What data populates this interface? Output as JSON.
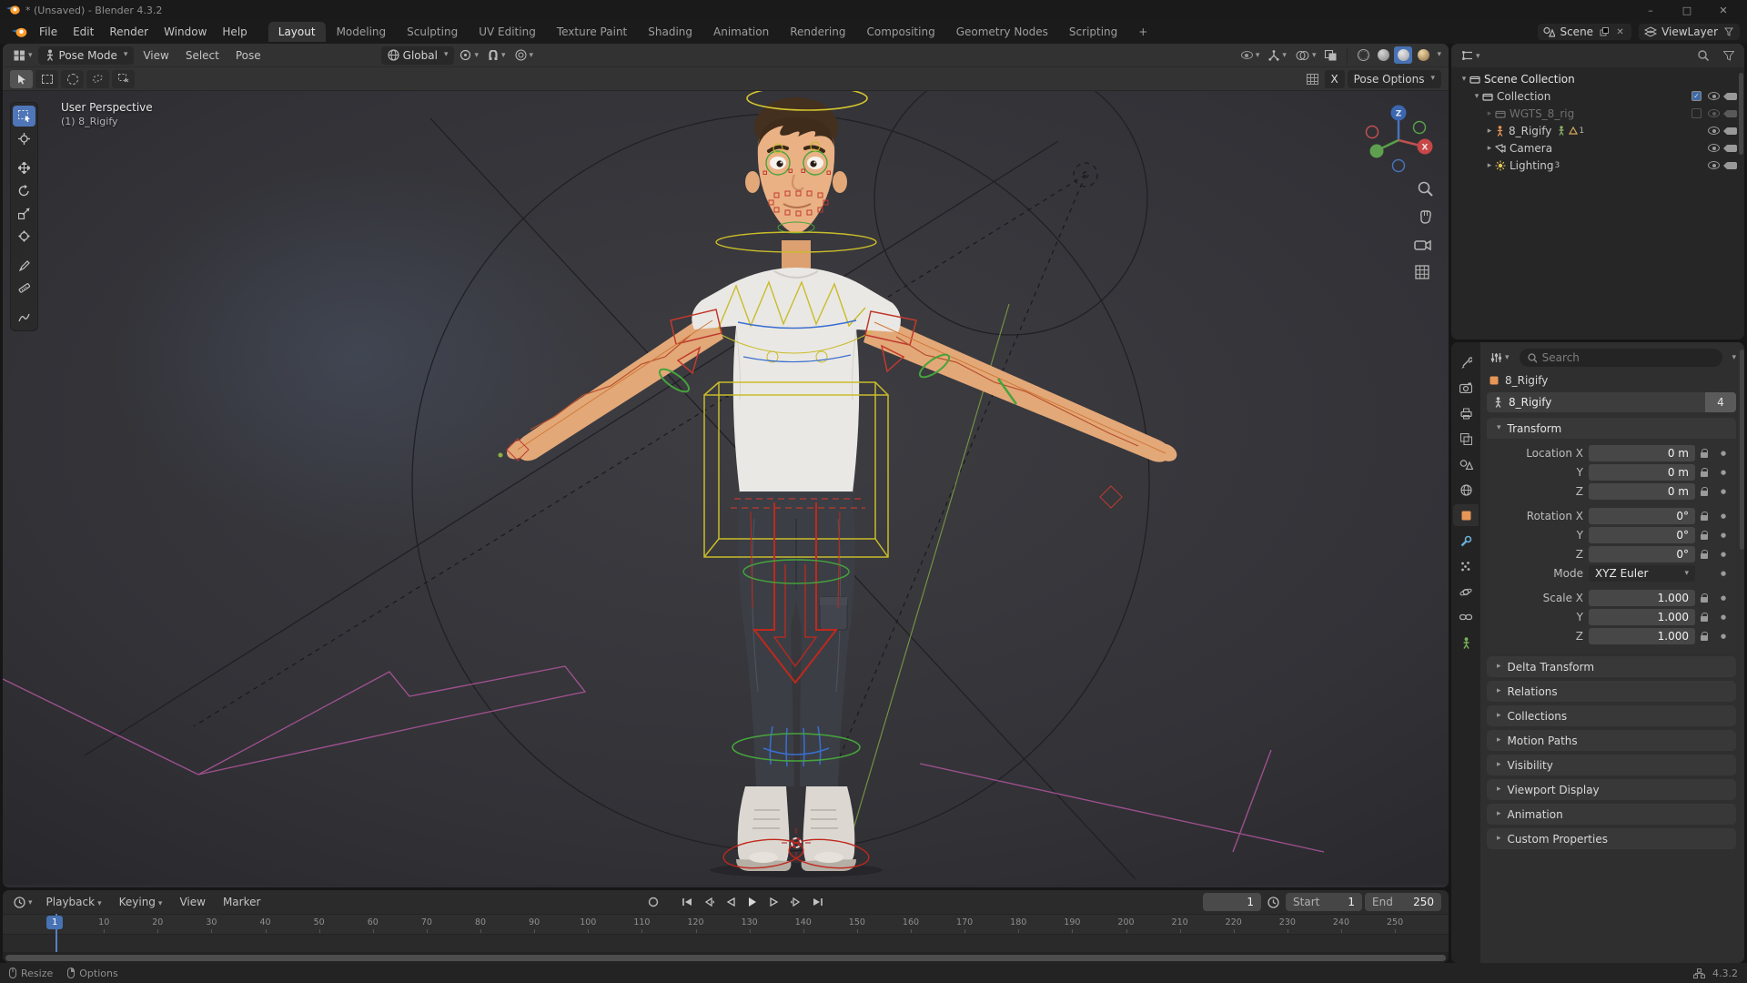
{
  "colors": {
    "accent": "#4772b3",
    "axis_x": "#c54747",
    "axis_y": "#5fa04f",
    "axis_z": "#3b66b0",
    "rig_yellow": "#c9bc2a",
    "rig_red": "#c0392b",
    "rig_green": "#46a33c",
    "rig_blue": "#3a6fd0",
    "rig_pink": "#b0569c",
    "rig_orange": "#d07838"
  },
  "icons": {
    "chevron_down": "▾",
    "chevron_right": "▸",
    "check": "✓",
    "close": "✕",
    "dot": "●",
    "minimize": "–",
    "maximize": "□",
    "plus": "+"
  },
  "titlebar": {
    "title": "* (Unsaved) - Blender 4.3.2"
  },
  "menubar": {
    "menus": [
      "File",
      "Edit",
      "Render",
      "Window",
      "Help"
    ],
    "workspaces": [
      "Layout",
      "Modeling",
      "Sculpting",
      "UV Editing",
      "Texture Paint",
      "Shading",
      "Animation",
      "Rendering",
      "Compositing",
      "Geometry Nodes",
      "Scripting"
    ],
    "active_workspace": "Layout",
    "scene_label": "Scene",
    "viewlayer_label": "ViewLayer"
  },
  "viewport_header": {
    "mode": "Pose Mode",
    "menus": [
      "View",
      "Select",
      "Pose"
    ],
    "orientation": "Global"
  },
  "tool_settings": {
    "mirror_x": "X",
    "pose_options": "Pose Options"
  },
  "viewport": {
    "view_label": "User Perspective",
    "object_label": "(1) 8_Rigify",
    "gizmo": {
      "x": "X",
      "z": "Z"
    }
  },
  "outliner": {
    "rows": [
      {
        "label": "Scene Collection",
        "depth": 0
      },
      {
        "label": "Collection",
        "depth": 1
      },
      {
        "label": "WGTS_8_rig",
        "depth": 2
      },
      {
        "label": "8_Rigify",
        "depth": 2,
        "badge": "1"
      },
      {
        "label": "Camera",
        "depth": 2
      },
      {
        "label": "Lighting",
        "depth": 2,
        "badge": "3"
      }
    ]
  },
  "properties": {
    "search_placeholder": "Search",
    "breadcrumb": "8_Rigify",
    "name_field": {
      "value": "8_Rigify",
      "users": "4"
    },
    "transform": {
      "title": "Transform",
      "rows": [
        {
          "label": "Location X",
          "value": "0 m"
        },
        {
          "label": "Y",
          "value": "0 m"
        },
        {
          "label": "Z",
          "value": "0 m"
        },
        {
          "label": "Rotation X",
          "value": "0°"
        },
        {
          "label": "Y",
          "value": "0°"
        },
        {
          "label": "Z",
          "value": "0°"
        },
        {
          "label": "Mode",
          "value": "XYZ Euler"
        },
        {
          "label": "Scale X",
          "value": "1.000"
        },
        {
          "label": "Y",
          "value": "1.000"
        },
        {
          "label": "Z",
          "value": "1.000"
        }
      ]
    },
    "sections": [
      "Delta Transform",
      "Relations",
      "Collections",
      "Motion Paths",
      "Visibility",
      "Viewport Display",
      "Animation",
      "Custom Properties"
    ]
  },
  "timeline": {
    "menus": [
      "Playback",
      "Keying",
      "View",
      "Marker"
    ],
    "current_frame": "1",
    "playhead_frame": "1",
    "start": {
      "label": "Start",
      "value": "1"
    },
    "end": {
      "label": "End",
      "value": "250"
    },
    "ticks": [
      10,
      20,
      30,
      40,
      50,
      60,
      70,
      80,
      90,
      100,
      110,
      120,
      130,
      140,
      150,
      160,
      170,
      180,
      190,
      200,
      210,
      220,
      230,
      240,
      250
    ]
  },
  "statusbar": {
    "left": [
      "Resize",
      "Options"
    ],
    "version": "4.3.2"
  }
}
